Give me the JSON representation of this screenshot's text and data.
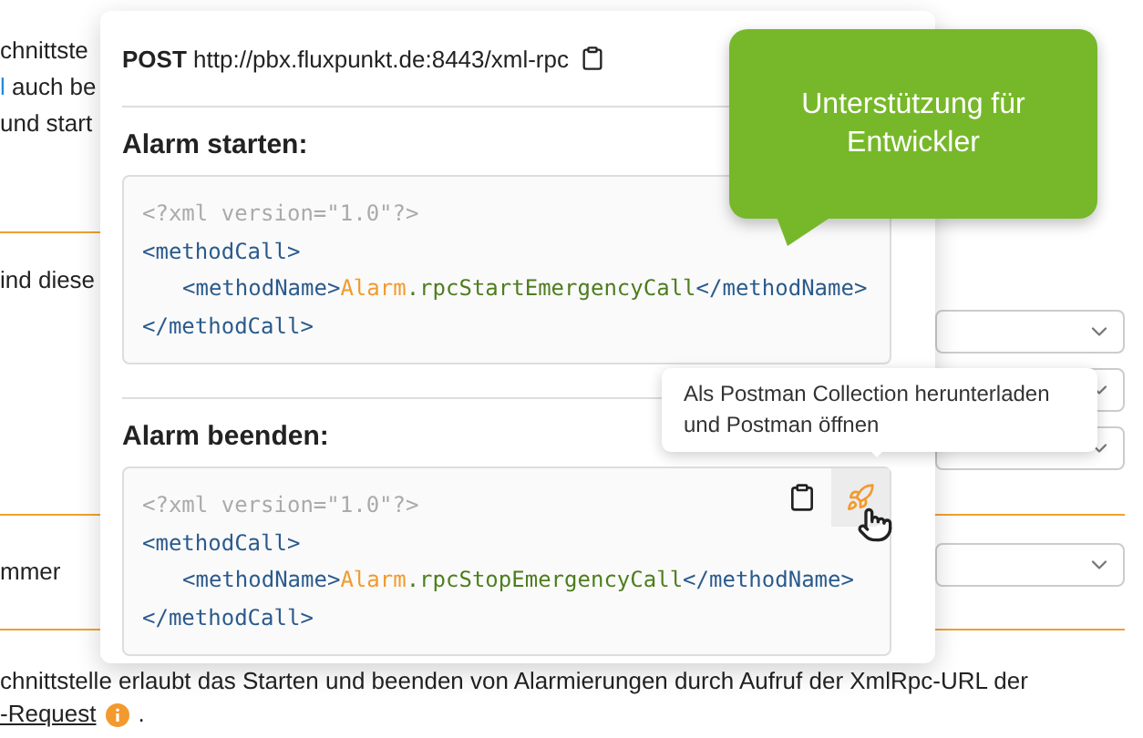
{
  "background": {
    "intro_lines": [
      [
        {
          "kind": "plain",
          "text": "chnittste"
        }
      ],
      [
        {
          "kind": "link",
          "text": "l"
        },
        {
          "kind": "plain",
          "text": " auch be"
        }
      ],
      [
        {
          "kind": "plain",
          "text": "und start"
        }
      ]
    ],
    "settings": [
      {
        "label": "ind diese"
      },
      {
        "label": "mmer"
      }
    ],
    "footer": {
      "text": "chnittstelle erlaubt das Starten und beenden von Alarmierungen durch Aufruf der XmlRpc-URL der",
      "link": "-Request",
      "tail": "."
    }
  },
  "popup": {
    "method": "POST",
    "url": "http://pbx.fluxpunkt.de:8443/xml-rpc",
    "blocks": [
      {
        "title": "Alarm starten:",
        "decl": "<?xml version=\"1.0\"?>",
        "open": "<methodCall>",
        "name_open": "<methodName>",
        "object": "Alarm",
        "method": ".rpcStartEmergencyCall",
        "name_close": "</methodName>",
        "close": "</methodCall>",
        "hovered": false
      },
      {
        "title": "Alarm beenden:",
        "decl": "<?xml version=\"1.0\"?>",
        "open": "<methodCall>",
        "name_open": "<methodName>",
        "object": "Alarm",
        "method": ".rpcStopEmergencyCall",
        "name_close": "</methodName>",
        "close": "</methodCall>",
        "hovered": true
      }
    ]
  },
  "callout": {
    "text": "Unterstützung für Entwickler"
  },
  "tooltip": {
    "text": "Als Postman Collection herunterladen und Postman öffnen"
  }
}
